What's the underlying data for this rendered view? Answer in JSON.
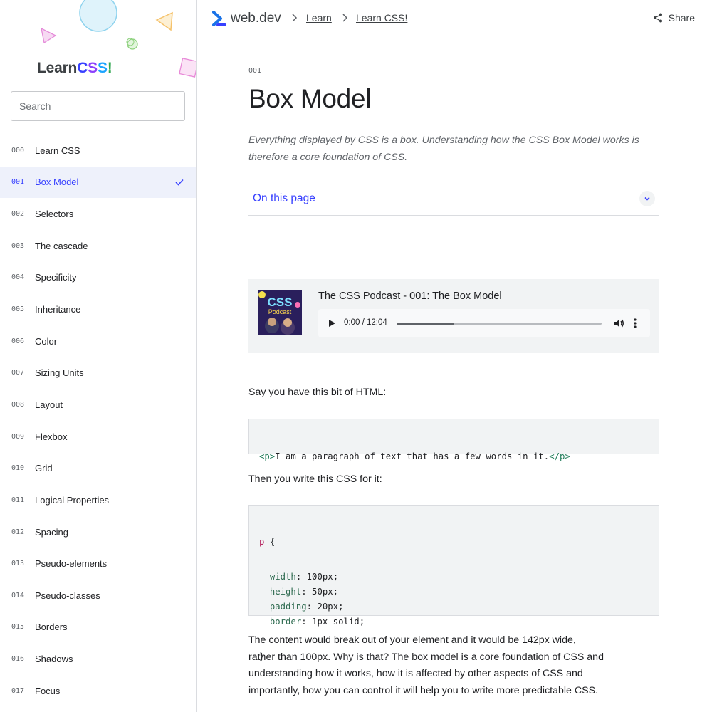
{
  "sidebar": {
    "brand_learn": "Learn",
    "brand_css_letters": [
      {
        "ch": "C",
        "color": "#3740ff"
      },
      {
        "ch": "S",
        "color": "#8a3ffc"
      },
      {
        "ch": "S",
        "color": "#1aa3ff"
      },
      {
        "ch": "!",
        "color": "#34a853"
      }
    ],
    "search_placeholder": "Search",
    "items": [
      {
        "num": "000",
        "label": "Learn CSS",
        "active": false
      },
      {
        "num": "001",
        "label": "Box Model",
        "active": true
      },
      {
        "num": "002",
        "label": "Selectors",
        "active": false
      },
      {
        "num": "003",
        "label": "The cascade",
        "active": false
      },
      {
        "num": "004",
        "label": "Specificity",
        "active": false
      },
      {
        "num": "005",
        "label": "Inheritance",
        "active": false
      },
      {
        "num": "006",
        "label": "Color",
        "active": false
      },
      {
        "num": "007",
        "label": "Sizing Units",
        "active": false
      },
      {
        "num": "008",
        "label": "Layout",
        "active": false
      },
      {
        "num": "009",
        "label": "Flexbox",
        "active": false
      },
      {
        "num": "010",
        "label": "Grid",
        "active": false
      },
      {
        "num": "011",
        "label": "Logical Properties",
        "active": false
      },
      {
        "num": "012",
        "label": "Spacing",
        "active": false
      },
      {
        "num": "013",
        "label": "Pseudo-elements",
        "active": false
      },
      {
        "num": "014",
        "label": "Pseudo-classes",
        "active": false
      },
      {
        "num": "015",
        "label": "Borders",
        "active": false
      },
      {
        "num": "016",
        "label": "Shadows",
        "active": false
      },
      {
        "num": "017",
        "label": "Focus",
        "active": false
      }
    ]
  },
  "topbar": {
    "logo_text": "web.dev",
    "breadcrumb": [
      "Learn",
      "Learn CSS!"
    ],
    "share_label": "Share"
  },
  "article": {
    "eyebrow": "001",
    "title": "Box Model",
    "lede": "Everything displayed by CSS is a box. Understanding how the CSS Box Model works is therefore a core foundation of CSS.",
    "toc_label": "On this page",
    "podcast": {
      "title": "The CSS Podcast - 001: The Box Model",
      "art_text_1": "CSS",
      "art_text_2": "Podcast",
      "time": "0:00 / 12:04",
      "progress_fraction": 0.28
    },
    "para_1": "Say you have this bit of HTML:",
    "code_1": {
      "open_tag": "<p>",
      "text": "I am a paragraph of text that has a few words in it.",
      "close_tag": "</p>"
    },
    "para_2": "Then you write this CSS for it:",
    "code_2": {
      "selector": "p",
      "open_brace": "{",
      "close_brace": "}",
      "declarations": [
        {
          "prop": "width",
          "value": "100px"
        },
        {
          "prop": "height",
          "value": "50px"
        },
        {
          "prop": "padding",
          "value": "20px"
        },
        {
          "prop": "border",
          "value": "1px solid"
        }
      ]
    },
    "para_3": "The content would break out of your element and it would be 142px wide, rather than 100px. Why is that? The box model is a core foundation of CSS and understanding how it works, how it is affected by other aspects of CSS and importantly, how you can control it will help you to write more predictable CSS."
  },
  "colors": {
    "accent": "#3740ff",
    "active_bg": "#eef1fb"
  }
}
